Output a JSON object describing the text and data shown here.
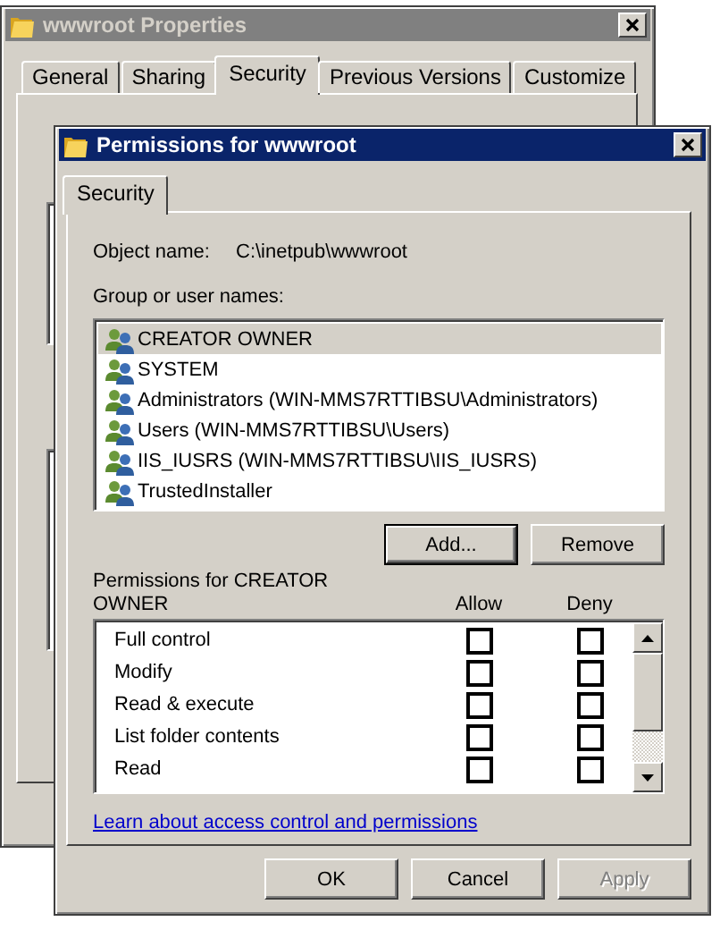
{
  "properties_window": {
    "title": "wwwroot Properties",
    "active": false,
    "tabs": [
      {
        "label": "General",
        "selected": false
      },
      {
        "label": "Sharing",
        "selected": false
      },
      {
        "label": "Security",
        "selected": true
      },
      {
        "label": "Previous Versions",
        "selected": false
      },
      {
        "label": "Customize",
        "selected": false
      }
    ],
    "panel_items": [
      {
        "kind": "listbox"
      },
      {
        "kind": "listbox"
      }
    ]
  },
  "permissions_dialog": {
    "title": "Permissions for wwwroot",
    "active": true,
    "tabs": [
      {
        "label": "Security",
        "selected": true
      }
    ],
    "object_name_label": "Object name:",
    "object_name": "C:\\inetpub\\wwwroot",
    "group_label": "Group or user names:",
    "users": [
      {
        "name": "CREATOR OWNER",
        "selected": true
      },
      {
        "name": "SYSTEM",
        "selected": false
      },
      {
        "name": "Administrators (WIN-MMS7RTTIBSU\\Administrators)",
        "selected": false
      },
      {
        "name": "Users (WIN-MMS7RTTIBSU\\Users)",
        "selected": false
      },
      {
        "name": "IIS_IUSRS (WIN-MMS7RTTIBSU\\IIS_IUSRS)",
        "selected": false
      },
      {
        "name": "TrustedInstaller",
        "selected": false
      }
    ],
    "user_buttons": [
      {
        "label": "Add...",
        "default": true
      },
      {
        "label": "Remove",
        "default": false
      }
    ],
    "permissions_label": "Permissions for CREATOR OWNER",
    "allow_header": "Allow",
    "deny_header": "Deny",
    "permissions": [
      {
        "name": "Full control",
        "allow": false,
        "deny": false
      },
      {
        "name": "Modify",
        "allow": false,
        "deny": false
      },
      {
        "name": "Read & execute",
        "allow": false,
        "deny": false
      },
      {
        "name": "List folder contents",
        "allow": false,
        "deny": false
      },
      {
        "name": "Read",
        "allow": false,
        "deny": false
      }
    ],
    "link": "Learn about access control and permissions",
    "footer_buttons": [
      {
        "label": "OK",
        "disabled": false
      },
      {
        "label": "Cancel",
        "disabled": false
      },
      {
        "label": "Apply",
        "disabled": true
      }
    ]
  }
}
